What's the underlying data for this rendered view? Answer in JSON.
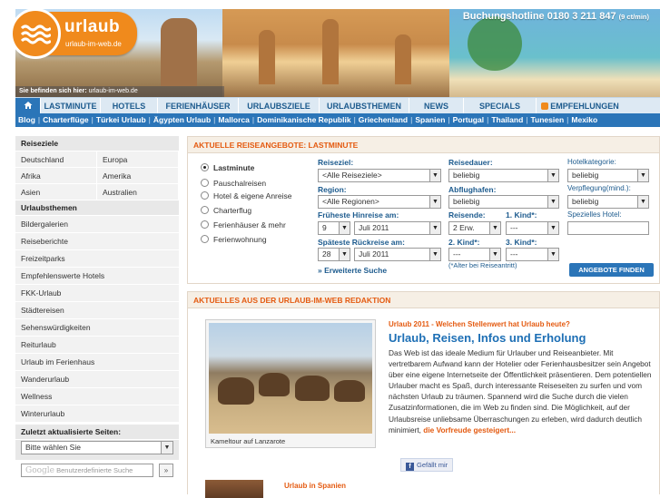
{
  "header": {
    "logo_text": "urlaub",
    "logo_sub": "urlaub-im-web.de",
    "hotline_label": "Buchungshotline 0180 3 211 847",
    "hotline_note": "(9 ct/min)",
    "breadcrumb_label": "Sie befinden sich hier:",
    "breadcrumb_value": "urlaub-im-web.de"
  },
  "nav": {
    "home_icon": "home-icon",
    "items": [
      "LASTMINUTE",
      "HOTELS",
      "FERIENHÄUSER",
      "URLAUBSZIELE",
      "URLAUBSTHEMEN",
      "NEWS",
      "SPECIALS",
      "EMPFEHLUNGEN"
    ]
  },
  "subnav": [
    "Blog",
    "Charterflüge",
    "Türkei Urlaub",
    "Ägypten Urlaub",
    "Mallorca",
    "Dominikanische Republik",
    "Griechenland",
    "Spanien",
    "Portugal",
    "Thailand",
    "Tunesien",
    "Mexiko"
  ],
  "sidebar": {
    "destinations_head": "Reiseziele",
    "destinations": [
      "Deutschland",
      "Europa",
      "Afrika",
      "Amerika",
      "Asien",
      "Australien"
    ],
    "themes_head": "Urlaubsthemen",
    "themes": [
      "Bildergalerien",
      "Reiseberichte",
      "Freizeitparks",
      "Empfehlenswerte Hotels",
      "FKK-Urlaub",
      "Städtereisen",
      "Sehenswürdigkeiten",
      "Reiturlaub",
      "Urlaub im Ferienhaus",
      "Wanderurlaub",
      "Wellness",
      "Winterurlaub"
    ],
    "recent_head": "Zuletzt aktualisierte Seiten:",
    "recent_select": "Bitte wählen Sie",
    "google_brand": "Google",
    "google_placeholder": "Benutzerdefinierte Suche",
    "google_button": "»"
  },
  "offers": {
    "title": "AKTUELLE REISEANGEBOTE: LASTMINUTE",
    "types": [
      "Lastminute",
      "Pauschalreisen",
      "Hotel & eigene Anreise",
      "Charterflug",
      "Ferienhäuser & mehr",
      "Ferienwohnung"
    ],
    "selected_type": 0,
    "reiseziel_label": "Reiseziel:",
    "reiseziel_value": "<Alle Reiseziele>",
    "region_label": "Region:",
    "region_value": "<Alle Regionen>",
    "hinreise_label": "Früheste Hinreise am:",
    "hinreise_day": "9",
    "hinreise_month": "Juli 2011",
    "rueckreise_label": "Späteste Rückreise am:",
    "rueckreise_day": "28",
    "rueckreise_month": "Juli 2011",
    "more_search": "» Erweiterte Suche",
    "dauer_label": "Reisedauer:",
    "dauer_value": "beliebig",
    "flughafen_label": "Abflughafen:",
    "flughafen_value": "beliebig",
    "reisende_label": "Reisende:",
    "reisende_value": "2 Erw.",
    "kind1_label": "1. Kind*:",
    "kind1_value": "---",
    "kind2_label": "2. Kind*:",
    "kind2_value": "---",
    "kind3_label": "3. Kind*:",
    "kind3_value": "---",
    "kind_note": "(*Alter bei Reiseantritt)",
    "kategorie_label": "Hotelkategorie:",
    "kategorie_value": "beliebig",
    "verpflegung_label": "Verpflegung(mind.):",
    "verpflegung_value": "beliebig",
    "hotel_label": "Spezielles Hotel:",
    "hotel_value": "",
    "search_button": "ANGEBOTE FINDEN"
  },
  "news": {
    "title": "AKTUELLES AUS DER URLAUB-IM-WEB REDAKTION",
    "image_caption": "Kameltour auf Lanzarote",
    "kicker": "Urlaub 2011 - Welchen Stellenwert hat Urlaub heute?",
    "headline": "Urlaub, Reisen, Infos und Erholung",
    "body": "Das Web ist das ideale Medium für Urlauber und Reiseanbieter. Mit vertretbarem Aufwand kann der Hotelier oder Ferienhausbesitzer sein Angebot über eine eigene Internetseite der Öffentlichkeit präsentieren. Dem potentiellen Urlauber macht es Spaß, durch interessante Reiseseiten zu surfen und vom nächsten Urlaub zu träumen. Spannend wird die Suche durch die vielen Zusatzinformationen, die im Web zu finden sind. Die Möglichkeit, auf der Urlaubsreise unliebsame Überraschungen zu erleben, wird dadurch deutlich minimiert,",
    "more_link": "die Vorfreude gesteigert...",
    "like_button": "Gefällt mir",
    "second_kicker": "Urlaub in Spanien",
    "second_line": ""
  },
  "colors": {
    "brand_orange": "#f08a1c",
    "nav_blue": "#2b75b8",
    "headline_blue": "#1d6fb5",
    "accent_red": "#e45a10"
  }
}
